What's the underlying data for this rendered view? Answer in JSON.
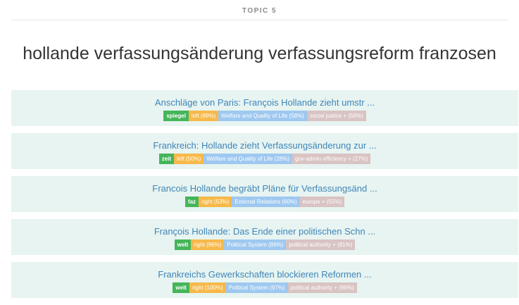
{
  "header": {
    "topic_label": "TOPIC 5"
  },
  "title": "hollande verfassungsänderung verfassungsreform franzosen",
  "articles": [
    {
      "title": "Anschläge von Paris: François Hollande zieht umstr ...",
      "tags": {
        "source": "spiegel",
        "lean": "left (89%)",
        "topic": "Welfare and Quality of Life (58%)",
        "detail": "social justice + (56%)"
      }
    },
    {
      "title": "Frankreich: Hollande zieht Verfassungsänderung zur ...",
      "tags": {
        "source": "zeit",
        "lean": "left (50%)",
        "topic": "Welfare and Quality of Life (28%)",
        "detail": "gov-admin efficiency + (27%)"
      }
    },
    {
      "title": "Francois Hollande begräbt Pläne für Verfassungsänd ...",
      "tags": {
        "source": "faz",
        "lean": "right (53%)",
        "topic": "External Relations (60%)",
        "detail": "europe + (55%)"
      }
    },
    {
      "title": "François Hollande: Das Ende einer politischen Schn ...",
      "tags": {
        "source": "welt",
        "lean": "right (96%)",
        "topic": "Political System (86%)",
        "detail": "political authority + (81%)"
      }
    },
    {
      "title": "Frankreichs Gewerkschaften blockieren Reformen ...",
      "tags": {
        "source": "welt",
        "lean": "right (100%)",
        "topic": "Political System (97%)",
        "detail": "political authority + (96%)"
      }
    }
  ],
  "colors": {
    "source_tag": "#45b55a",
    "lean_tag": "#f6b94a",
    "topic_tag": "#9ec8f0",
    "detail_tag": "#d9c3c3",
    "card_background": "#e7f4f1",
    "link": "#3f85b8"
  }
}
